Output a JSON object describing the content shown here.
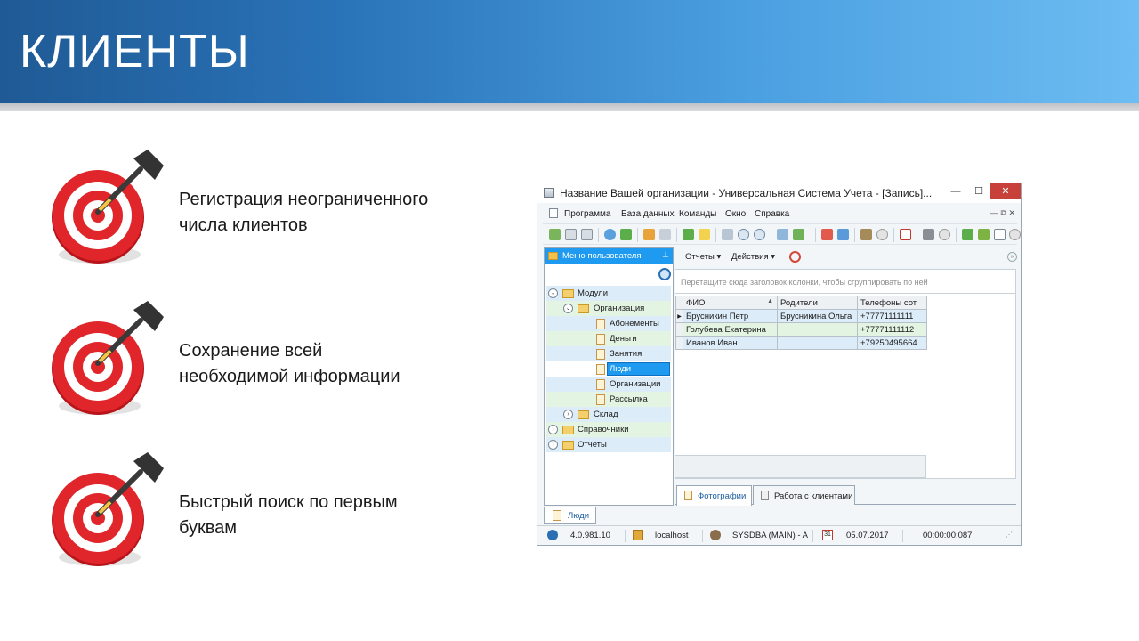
{
  "slide": {
    "title": "КЛИЕНТЫ",
    "bullets": [
      {
        "line1": "Регистрация неограниченного",
        "line2": "числа клиентов"
      },
      {
        "line1": "Сохранение всей",
        "line2": "необходимой информации"
      },
      {
        "line1": "Быстрый поиск по первым",
        "line2": "буквам"
      }
    ]
  },
  "app": {
    "window_title": "Название Вашей организации - Универсальная Система Учета - [Запись]...",
    "window_buttons": {
      "minimize": "—",
      "maximize": "☐",
      "close": "✕"
    },
    "menu": [
      "Программа",
      "База данных",
      "Команды",
      "Окно",
      "Справка"
    ],
    "mdi_controls": "— ⧉ ✕",
    "left_panel": {
      "title": "Меню пользователя",
      "pin": "⊥",
      "tree": [
        {
          "label": "Модули",
          "expander": "⌄"
        },
        {
          "label": "Организация",
          "expander": "⌄"
        },
        {
          "label": "Абонементы"
        },
        {
          "label": "Деньги"
        },
        {
          "label": "Занятия"
        },
        {
          "label": "Люди"
        },
        {
          "label": "Организации"
        },
        {
          "label": "Рассылка"
        },
        {
          "label": "Склад",
          "expander": "›"
        },
        {
          "label": "Справочники",
          "expander": "›"
        },
        {
          "label": "Отчеты",
          "expander": "›"
        }
      ]
    },
    "right_toolbar": {
      "reports": "Отчеты ▾",
      "actions": "Действия ▾",
      "close": "»"
    },
    "group_hint": "Перетащите сюда заголовок колонки, чтобы сгруппировать по ней",
    "grid": {
      "columns": [
        "ФИО",
        "Родители",
        "Телефоны сот."
      ],
      "sort_indicator": "▲",
      "rows": [
        {
          "indicator": "▶",
          "fio": "Брусникин Петр",
          "parents": "Брусникина Ольга",
          "phone": "+77771111111"
        },
        {
          "indicator": "",
          "fio": "Голубева Екатерина",
          "parents": "",
          "phone": "+77771111112"
        },
        {
          "indicator": "",
          "fio": "Иванов Иван",
          "parents": "",
          "phone": "+79250495664"
        }
      ]
    },
    "grip": "......",
    "tabs": [
      "Фотографии",
      "Работа с клиентами"
    ],
    "bottom_tab": "Люди",
    "status": {
      "version": "4.0.981.10",
      "host": "localhost",
      "user": "SYSDBA (MAIN) - A",
      "date": "05.07.2017",
      "timer": "00:00:00:087",
      "calendar_day": "31"
    },
    "colors": {
      "header_gradient_start": "#1f5a95",
      "header_gradient_end": "#6dbcf2",
      "selection": "#1e9bf0",
      "row_blue": "#dcecf8",
      "row_green": "#e3f4e3",
      "close_button": "#c7413a"
    }
  }
}
